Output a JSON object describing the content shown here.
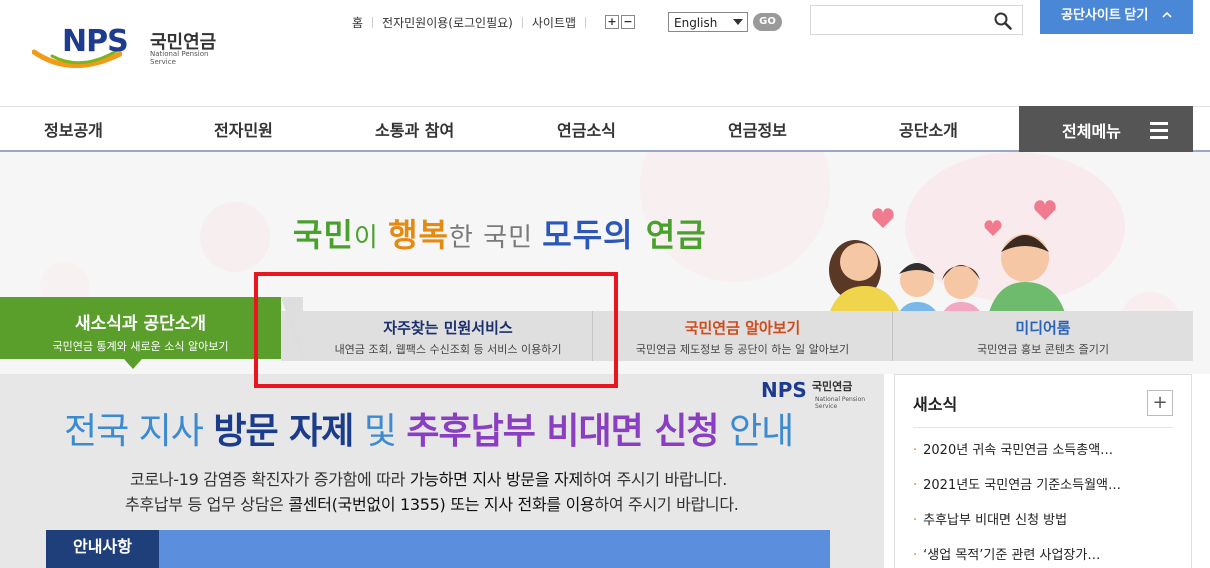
{
  "brand": {
    "logo_text": "NPS",
    "logo_korean": "국민연금",
    "logo_english": "National Pension Service"
  },
  "utility": {
    "links": [
      "홈",
      "전자민원이용(로그인필요)",
      "사이트맵"
    ],
    "zoom_in": "+",
    "zoom_out": "−",
    "language_selected": "English",
    "go_label": "GO",
    "search_value": "",
    "close_site_label": "공단사이트 닫기"
  },
  "nav": {
    "items": [
      "정보공개",
      "전자민원",
      "소통과 참여",
      "연금소식",
      "연금정보",
      "공단소개"
    ],
    "all_menu_label": "전체메뉴"
  },
  "banner": {
    "slogan": [
      "국민",
      "이 ",
      "행복",
      "한 국민 ",
      "모두의",
      " 연금"
    ]
  },
  "tabs": {
    "active": {
      "title": "새소식과 공단소개",
      "subtitle": "국민연금 통계와 새로운 소식 알아보기"
    },
    "items": [
      {
        "title": "자주찾는 민원서비스",
        "subtitle": "내연금 조회, 웹팩스 수신조회 등 서비스 이용하기"
      },
      {
        "title": "국민연금 알아보기",
        "subtitle": "국민연금 제도정보 등 공단이 하는 일 알아보기"
      },
      {
        "title": "미디어룸",
        "subtitle": "국민연금 홍보 콘텐츠 즐기기"
      }
    ],
    "colors": [
      "#1b2f6b",
      "#d04a1a",
      "#2b63b8"
    ]
  },
  "notice": {
    "logo_text": "NPS",
    "logo_korean": "국민연금",
    "logo_english": "National Pension Service",
    "title_parts": [
      "전국 지사 ",
      "방문 자제",
      " 및 ",
      "추후납부 비대면 신청",
      " 안내"
    ],
    "line1": [
      "코로나-19 감염증 확진자가 증가함에 따라 ",
      "가능하면 지사 방문을 자제",
      "하여 주시기 바랍니다."
    ],
    "line2": [
      "추후납부 등 업무 상담은 ",
      "콜센터(국번없이 1355) 또는 지사 전화를 이용",
      "하여 주시기 바랍니다."
    ],
    "tag": "안내사항"
  },
  "news": {
    "title": "새소식",
    "more": "+",
    "items": [
      "2020년 귀속 국민연금 소득총액…",
      "2021년도 국민연금 기준소득월액…",
      "추후납부 비대면 신청 방법",
      "‘생업 목적’기준 관련 사업장가…"
    ]
  }
}
